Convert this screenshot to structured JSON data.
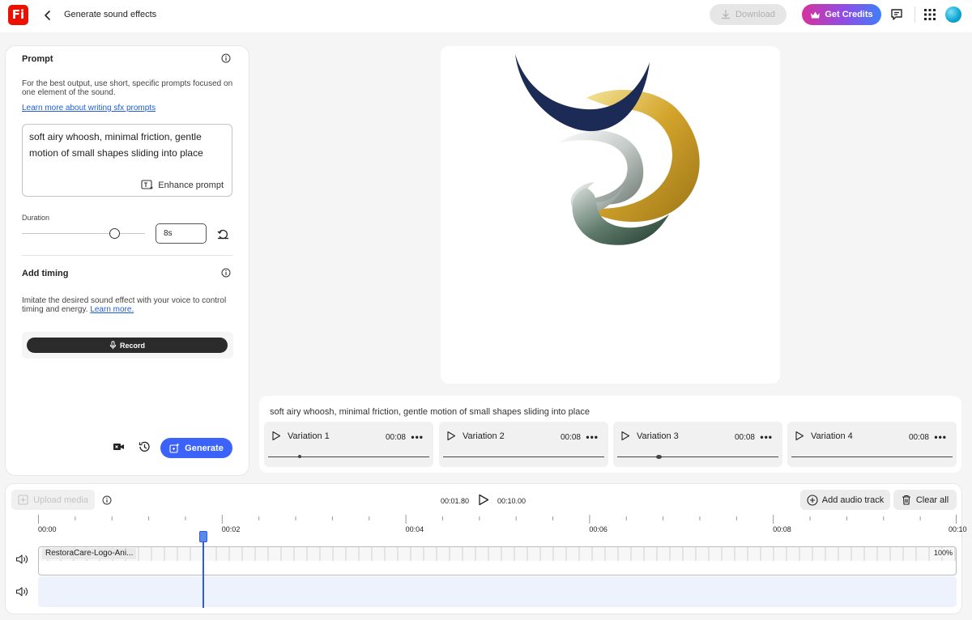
{
  "header": {
    "logo_text": "Fi",
    "title": "Generate sound effects",
    "download_label": "Download",
    "credits_label": "Get Credits"
  },
  "prompt_panel": {
    "title": "Prompt",
    "helper": "For the best output, use short, specific prompts focused on one element of the sound.",
    "learn_link": "Learn more about writing sfx prompts",
    "prompt_value": "soft airy whoosh, minimal friction, gentle motion of small shapes sliding into place",
    "enhance_label": "Enhance prompt",
    "duration_label": "Duration",
    "duration_value": "8s",
    "duration_slider_fraction": 0.8
  },
  "timing_panel": {
    "title": "Add timing",
    "helper": "Imitate the desired sound effect with your voice to control timing and energy.",
    "learn_link": "Learn more.",
    "record_label": "Record"
  },
  "generate_label": "Generate",
  "variations": {
    "prompt": "soft airy whoosh, minimal friction, gentle motion of small shapes sliding into place",
    "items": [
      {
        "name": "Variation 1",
        "duration": "00:08",
        "more": "•••"
      },
      {
        "name": "Variation 2",
        "duration": "00:08",
        "more": "•••"
      },
      {
        "name": "Variation 3",
        "duration": "00:08",
        "more": "•••"
      },
      {
        "name": "Variation 4",
        "duration": "00:08",
        "more": "•••"
      }
    ]
  },
  "timeline": {
    "upload_label": "Upload media",
    "current_time": "00:01.80",
    "total_time": "00:10.00",
    "add_track_label": "Add audio track",
    "clear_label": "Clear all",
    "ticks": [
      "00:00",
      "00:02",
      "00:04",
      "00:06",
      "00:08",
      "00:10"
    ],
    "clip_name": "RestoraCare-Logo-Ani...",
    "clip_zoom": "100%",
    "playhead_seconds": 1.8,
    "duration_seconds": 10
  },
  "colors": {
    "brand": "#eb1000",
    "accent": "#3b63fb",
    "playhead": "#2e5bd6"
  }
}
